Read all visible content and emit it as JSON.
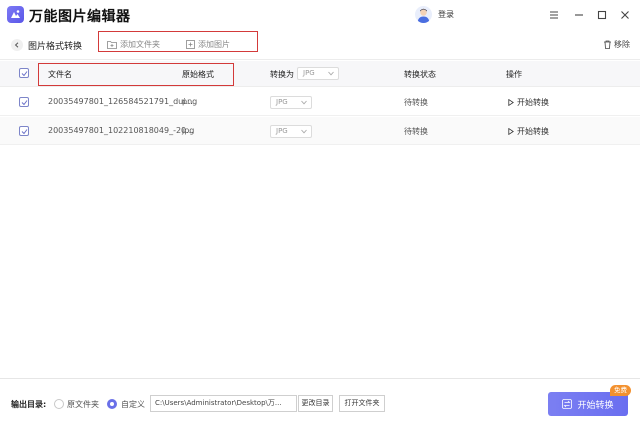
{
  "app": {
    "title": "万能图片编辑器",
    "login_label": "登录",
    "window_controls": [
      "menu-icon",
      "minimize-icon",
      "maximize-icon",
      "close-icon"
    ]
  },
  "toolbar": {
    "back_icon": "chevron-left-icon",
    "page_title": "图片格式转换",
    "add_folder_label": "添加文件夹",
    "add_image_label": "添加图片",
    "remove_label": "移除"
  },
  "table": {
    "headers": {
      "filename": "文件名",
      "original_format": "原始格式",
      "convert_to": "转换为",
      "convert_to_value": "JPG",
      "status": "转换状态",
      "action": "操作"
    },
    "rows": [
      {
        "checked": true,
        "filename": "20035497801_126584521791_dui...",
        "format": "png",
        "target": "JPG",
        "status": "待转换",
        "action": "开始转换"
      },
      {
        "checked": true,
        "filename": "20035497801_102210818049_-20...",
        "format": "jpg",
        "target": "JPG",
        "status": "待转换",
        "action": "开始转换"
      }
    ]
  },
  "footer": {
    "output_label": "输出目录:",
    "option_original": "原文件夹",
    "option_custom": "自定义",
    "selected_option": "自定义",
    "path_value": "C:\\Users\\Administrator\\Desktop\\万...",
    "change_dir_label": "更改目录",
    "open_folder_label": "打开文件夹",
    "convert_label": "开始转换",
    "free_badge": "免费"
  },
  "colors": {
    "accent": "#6a6ef0",
    "highlight": "#d33a3a",
    "badge": "#f3912f"
  }
}
